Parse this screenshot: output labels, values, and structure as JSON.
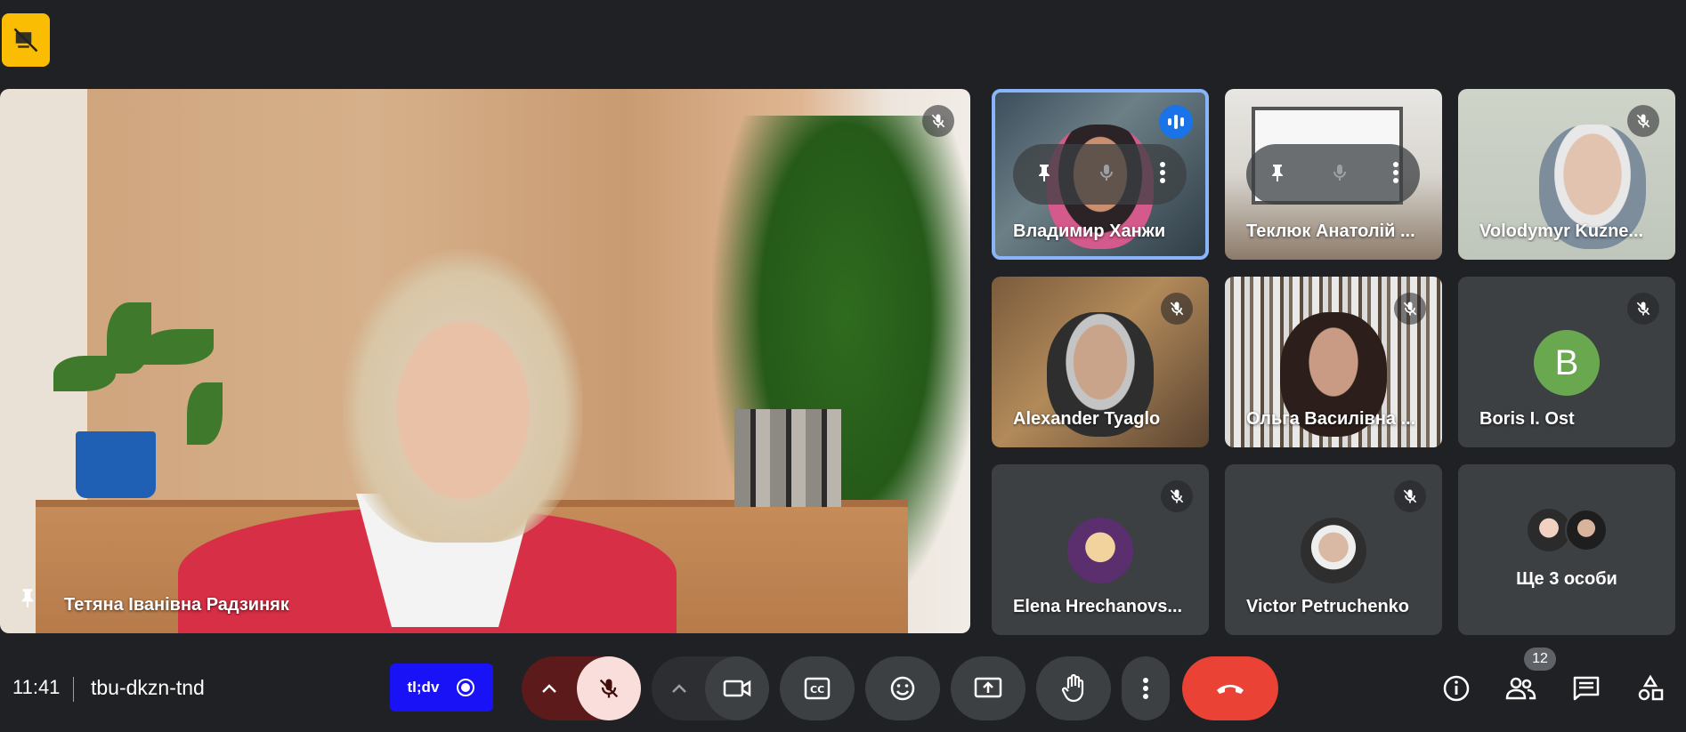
{
  "main_speaker": {
    "name": "Тетяна Іванівна Радзиняк"
  },
  "tiles": [
    {
      "name": "Владимир Ханжи",
      "state": "speaking"
    },
    {
      "name": "Теклюк Анатолій ..."
    },
    {
      "name": "Volodymyr Kuzne...",
      "state": "muted"
    },
    {
      "name": "Alexander Tyaglo",
      "state": "muted"
    },
    {
      "name": "Ольга Василівна ...",
      "state": "muted"
    },
    {
      "name": "Boris I. Ost",
      "avatar_letter": "B",
      "avatar_color": "#6aa84f",
      "state": "muted"
    },
    {
      "name": "Elena Hrechanovs...",
      "state": "muted"
    },
    {
      "name": "Victor Petruchenko",
      "state": "muted"
    },
    {
      "name": "Ще 3 особи"
    }
  ],
  "bottom_bar": {
    "time": "11:41",
    "meeting_code": "tbu-dkzn-tnd",
    "recorder_label": "tl;dv",
    "participants_count": "12"
  },
  "colors": {
    "background": "#202124",
    "accent_blue": "#8ab4f8",
    "end_call": "#ea4335",
    "mic_off_bg": "#f9dedc",
    "warning_badge": "#fbbc04"
  }
}
